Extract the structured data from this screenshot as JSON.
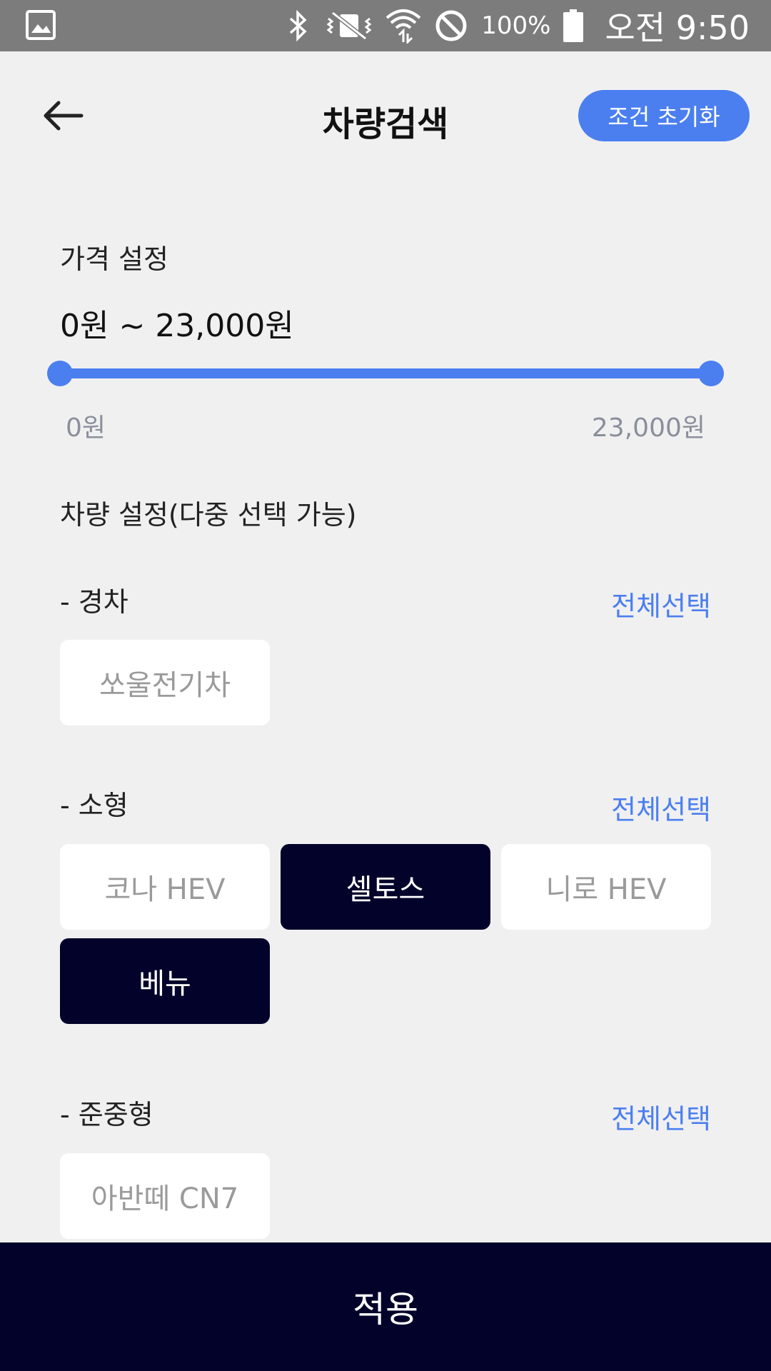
{
  "status_bar": {
    "battery_percent": "100%",
    "time": "오전 9:50",
    "icons": [
      "gallery-icon",
      "bluetooth-icon",
      "vibrate-icon",
      "wifi-icon",
      "do-not-disturb-icon",
      "battery-icon"
    ]
  },
  "header": {
    "title": "차량검색",
    "reset_label": "조건 초기화"
  },
  "price": {
    "section_label": "가격 설정",
    "range_text": "0원 ~ 23,000원",
    "min_label": "0원",
    "max_label": "23,000원",
    "selected_min_fraction": 0,
    "selected_max_fraction": 1
  },
  "vehicle": {
    "section_label": "차량 설정(다중 선택 가능)",
    "select_all_label": "전체선택",
    "categories": [
      {
        "label": "- 경차",
        "chips": [
          {
            "label": "쏘울전기차",
            "selected": false
          }
        ]
      },
      {
        "label": "- 소형",
        "chips": [
          {
            "label": "코나 HEV",
            "selected": false
          },
          {
            "label": "셀토스",
            "selected": true
          },
          {
            "label": "니로 HEV",
            "selected": false
          },
          {
            "label": "베뉴",
            "selected": true
          }
        ]
      },
      {
        "label": "- 준중형",
        "chips": [
          {
            "label": "아반떼 CN7",
            "selected": false
          }
        ]
      }
    ]
  },
  "footer": {
    "apply_label": "적용"
  },
  "colors": {
    "accent": "#4b7ff0",
    "dark": "#02022a",
    "background": "#f0f0f1"
  }
}
